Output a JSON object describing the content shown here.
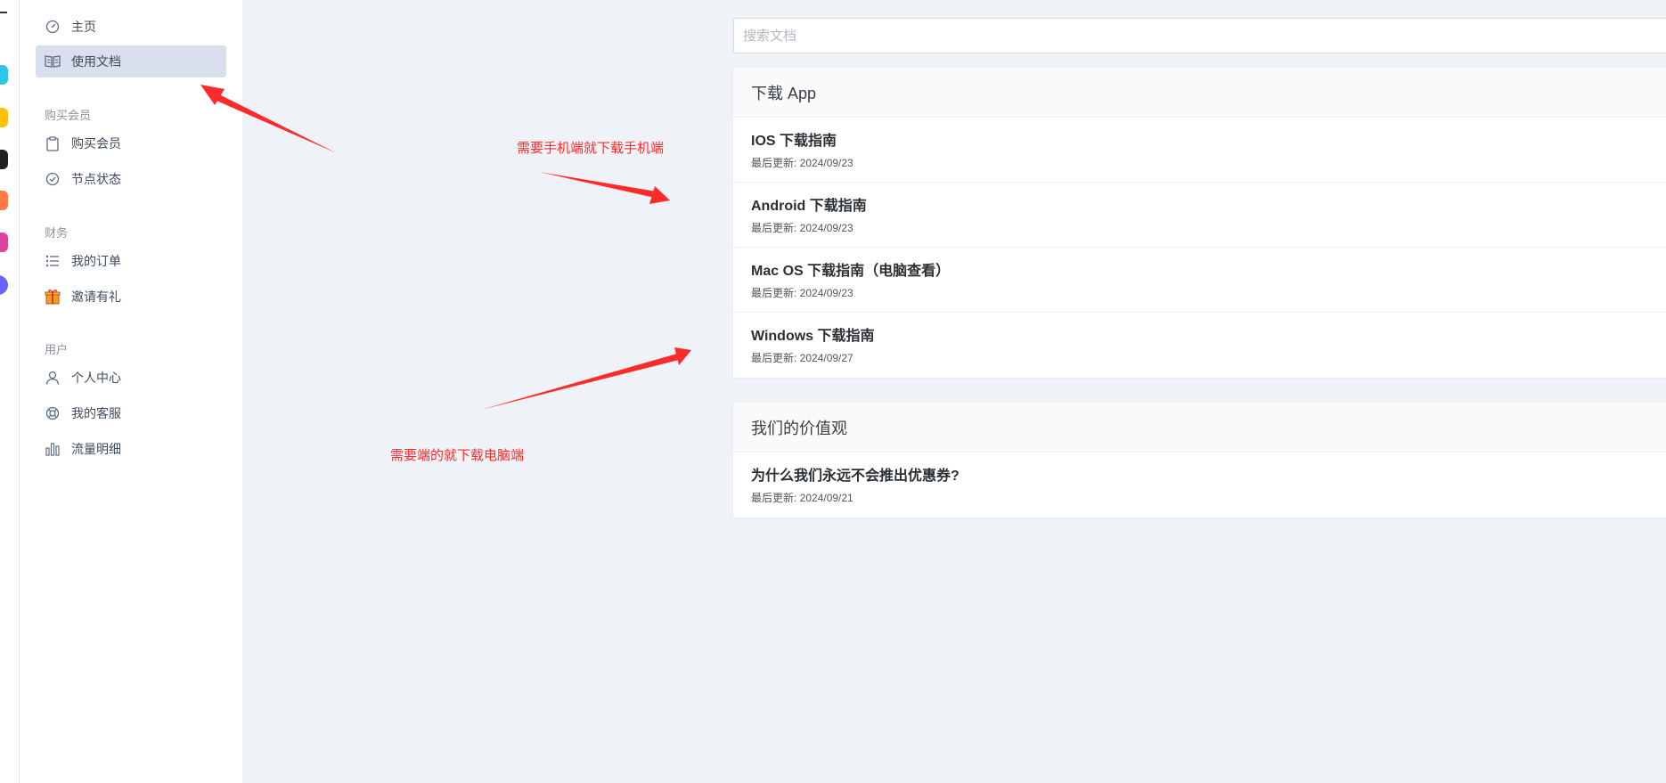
{
  "app_strip": {
    "icons": [
      {
        "name": "app-icon-cyan",
        "color": "#2ec5e8"
      },
      {
        "name": "app-icon-yellow",
        "color": "#ffc107"
      },
      {
        "name": "app-icon-black",
        "color": "#222222"
      },
      {
        "name": "app-icon-orange",
        "color": "#ff7a45"
      },
      {
        "name": "app-icon-pink",
        "color": "#e040a0"
      },
      {
        "name": "app-icon-purple",
        "color": "#6c63ff"
      }
    ]
  },
  "sidebar": {
    "items_top": [
      {
        "label": "主页",
        "icon": "dashboard-icon"
      },
      {
        "label": "使用文档",
        "icon": "book-icon",
        "active": true
      }
    ],
    "sections": [
      {
        "title": "购买会员",
        "items": [
          {
            "label": "购买会员",
            "icon": "clipboard-icon"
          },
          {
            "label": "节点状态",
            "icon": "check-circle-icon"
          }
        ]
      },
      {
        "title": "财务",
        "items": [
          {
            "label": "我的订单",
            "icon": "list-icon"
          },
          {
            "label": "邀请有礼",
            "icon": "gift-icon"
          }
        ]
      },
      {
        "title": "用户",
        "items": [
          {
            "label": "个人中心",
            "icon": "user-icon"
          },
          {
            "label": "我的客服",
            "icon": "lifebuoy-icon"
          },
          {
            "label": "流量明细",
            "icon": "bar-chart-icon"
          }
        ]
      }
    ]
  },
  "search": {
    "placeholder": "搜索文档",
    "value": ""
  },
  "cards": [
    {
      "title": "下载 App",
      "items": [
        {
          "title": "IOS 下载指南",
          "meta": "最后更新: 2024/09/23"
        },
        {
          "title": "Android 下载指南",
          "meta": "最后更新: 2024/09/23"
        },
        {
          "title": "Mac OS 下载指南（电脑查看）",
          "meta": "最后更新: 2024/09/23"
        },
        {
          "title": "Windows 下载指南",
          "meta": "最后更新: 2024/09/27"
        }
      ]
    },
    {
      "title": "我们的价值观",
      "items": [
        {
          "title": "为什么我们永远不会推出优惠券?",
          "meta": "最后更新: 2024/09/21"
        }
      ]
    }
  ],
  "annotations": {
    "mobile": "需要手机端就下载手机端",
    "desktop": "需要端的就下载电脑端"
  },
  "colors": {
    "accent_annotation": "#ff2a2a",
    "active_nav": "#d9dfec",
    "icon_gray": "#5d6b82"
  }
}
